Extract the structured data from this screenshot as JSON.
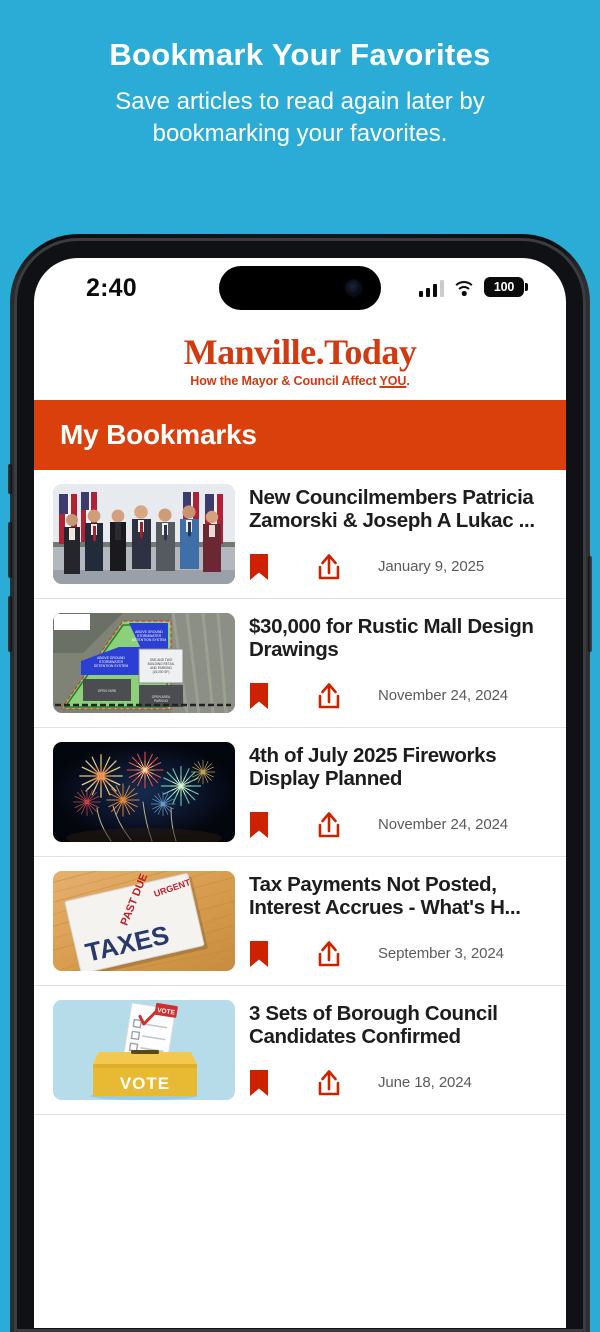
{
  "promo": {
    "title": "Bookmark Your Favorites",
    "subtitle": "Save articles to read again later by bookmarking your favorites.",
    "background_color": "#2BACD6",
    "text_color": "#FFFFFF"
  },
  "phone": {
    "status_bar": {
      "time": "2:40",
      "signal_icon": "cellular-bars-icon",
      "signal_bars_filled": 3,
      "signal_bars_total": 4,
      "wifi_icon": "wifi-icon",
      "battery_level": "100",
      "battery_icon": "battery-icon"
    }
  },
  "app": {
    "logo": {
      "name": "Manville.Today",
      "tagline_before": "How the Mayor & Council Affect ",
      "tagline_emphasis": "YOU",
      "tagline_after": ".",
      "color": "#D13B12"
    },
    "header": {
      "title": "My Bookmarks",
      "background_color": "#D9400B",
      "text_color": "#FFFFFF"
    },
    "accent_color": "#CC2200",
    "bookmarks": [
      {
        "title": "New Councilmembers Patricia Zamorski & Joseph A Lukac ...",
        "date": "January 9, 2025",
        "thumbnail": "council-group-photo",
        "bookmark_icon": "bookmark-filled-icon",
        "share_icon": "share-icon"
      },
      {
        "title": "$30,000 for Rustic Mall Design Drawings",
        "date": "November 24, 2024",
        "thumbnail": "site-plan-map",
        "bookmark_icon": "bookmark-filled-icon",
        "share_icon": "share-icon"
      },
      {
        "title": "4th of July 2025 Fireworks Display Planned",
        "date": "November 24, 2024",
        "thumbnail": "fireworks-photo",
        "bookmark_icon": "bookmark-filled-icon",
        "share_icon": "share-icon"
      },
      {
        "title": "Tax Payments Not Posted, Interest Accrues - What's H...",
        "date": "September 3, 2024",
        "thumbnail": "tax-envelope-photo",
        "bookmark_icon": "bookmark-filled-icon",
        "share_icon": "share-icon"
      },
      {
        "title": "3 Sets of Borough Council Candidates Confirmed",
        "date": "June 18, 2024",
        "thumbnail": "vote-ballot-box",
        "bookmark_icon": "bookmark-filled-icon",
        "share_icon": "share-icon"
      }
    ]
  }
}
